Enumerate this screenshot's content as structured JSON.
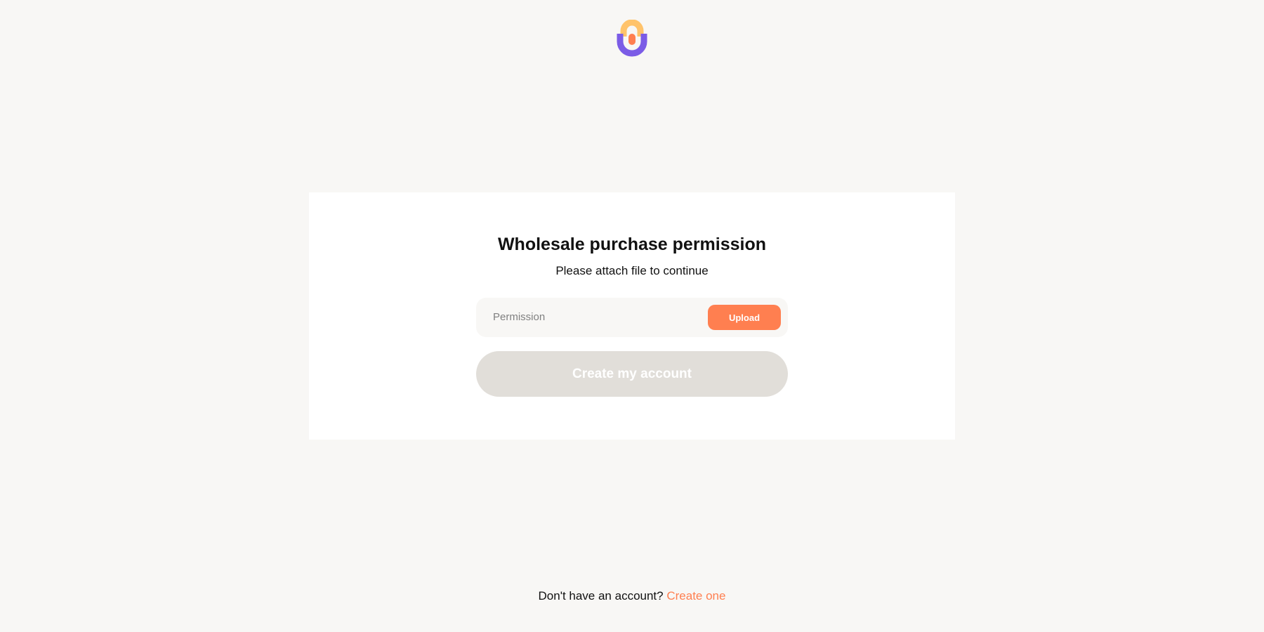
{
  "colors": {
    "accent": "#ff7f50",
    "logo_purple": "#7b5ce6",
    "logo_yellow": "#ffc36b",
    "disabled_button": "#e1ded9"
  },
  "card": {
    "title": "Wholesale purchase permission",
    "subtitle": "Please attach file to continue",
    "file_field": {
      "label": "Permission",
      "upload_label": "Upload"
    },
    "submit_label": "Create my account"
  },
  "footer": {
    "prompt": "Don't have an account?",
    "link_label": "Create one"
  }
}
